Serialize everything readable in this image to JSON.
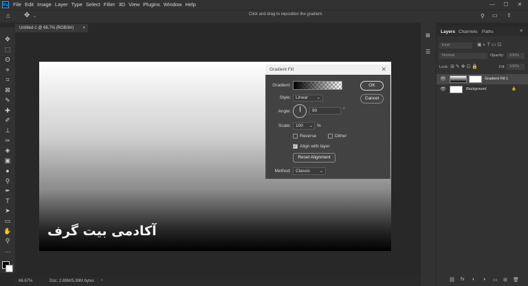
{
  "app": {
    "logo_text": "Ps"
  },
  "menu": [
    "File",
    "Edit",
    "Image",
    "Layer",
    "Type",
    "Select",
    "Filter",
    "3D",
    "View",
    "Plugins",
    "Window",
    "Help"
  ],
  "window_controls": {
    "minimize": "—",
    "maximize": "☐",
    "close": "✕"
  },
  "options_bar": {
    "hint": "Click and drag to reposition the gradient."
  },
  "document_tab": {
    "title": "Untitled-1 @ 66.7% (RGB/8#)",
    "close": "×"
  },
  "canvas": {
    "watermark": "آکادمی بیت گرف"
  },
  "status": {
    "zoom": "66.67%",
    "doc_info": "Doc: 2.88M/5.99M bytes",
    "arrow": "›"
  },
  "layers_panel": {
    "tabs": [
      "Layers",
      "Channels",
      "Paths"
    ],
    "kind_placeholder": "Kind",
    "blend_mode": "Normal",
    "opacity_label": "Opacity:",
    "opacity_value": "100%",
    "lock_label": "Lock:",
    "fill_label": "Fill:",
    "fill_value": "100%",
    "layers": [
      {
        "name": "Gradient Fill 1",
        "selected": true
      },
      {
        "name": "Background",
        "selected": false
      }
    ],
    "bottom_icons": [
      "⛓",
      "fx",
      "◐",
      "◑",
      "▭",
      "⊞",
      "🗑"
    ]
  },
  "dialog": {
    "title": "Gradient Fill",
    "close": "✕",
    "gradient_label": "Gradient:",
    "style_label": "Style:",
    "style_value": "Linear",
    "angle_label": "Angle:",
    "angle_value": "90",
    "angle_unit": "°",
    "scale_label": "Scale:",
    "scale_value": "100",
    "scale_unit": "%",
    "reverse_label": "Reverse",
    "dither_label": "Dither",
    "align_label": "Align with layer",
    "align_checked": true,
    "reset_label": "Reset Alignment",
    "method_label": "Method:",
    "method_value": "Classic",
    "ok_label": "OK",
    "cancel_label": "Cancel"
  }
}
